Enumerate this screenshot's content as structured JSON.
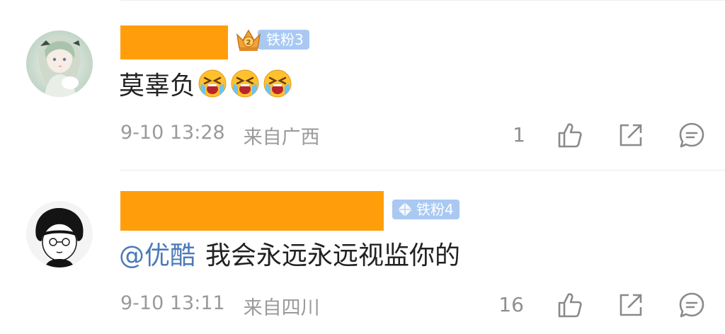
{
  "comments": [
    {
      "badge": {
        "label": "铁粉3",
        "icon": "crown-2-icon"
      },
      "content": {
        "text": "莫辜负",
        "emojis": [
          "crying-face-icon",
          "crying-face-icon",
          "crying-face-icon"
        ]
      },
      "meta": {
        "time": "9-10 13:28",
        "location": "来自广西"
      },
      "likes": "1"
    },
    {
      "badge": {
        "label": "铁粉4",
        "icon": "diamond-icon"
      },
      "content": {
        "mention": "@优酷",
        "text": "我会永远永远视监你的"
      },
      "meta": {
        "time": "9-10 13:11",
        "location": "来自四川"
      },
      "likes": "16"
    }
  ],
  "colors": {
    "redaction": "#ff9e0a",
    "badge_bg": "#a9c9f2",
    "mention": "#4b7ab8",
    "meta_text": "#9a9a9a",
    "icon_stroke": "#8a8a8a"
  }
}
